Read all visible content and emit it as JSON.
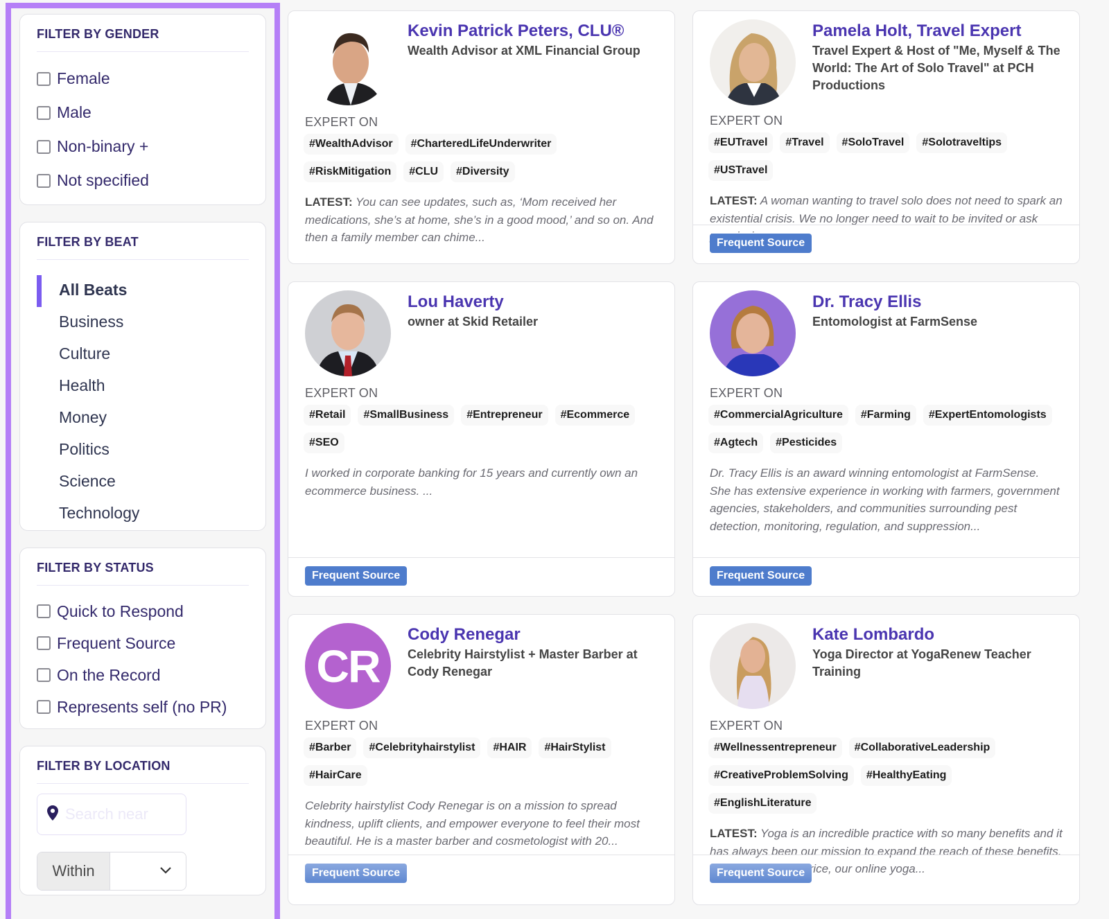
{
  "filters": {
    "gender": {
      "title": "FILTER BY GENDER",
      "options": [
        "Female",
        "Male",
        "Non-binary +",
        "Not specified"
      ]
    },
    "beat": {
      "title": "FILTER BY BEAT",
      "selected": "All Beats",
      "options": [
        "All Beats",
        "Business",
        "Culture",
        "Health",
        "Money",
        "Politics",
        "Science",
        "Technology"
      ]
    },
    "status": {
      "title": "FILTER BY STATUS",
      "options": [
        "Quick to Respond",
        "Frequent Source",
        "On the Record",
        "Represents self (no PR)"
      ]
    },
    "location": {
      "title": "FILTER BY LOCATION",
      "search_placeholder": "Search near",
      "search_icon": "map-pin-icon",
      "within_label": "Within",
      "within_value": ""
    }
  },
  "colors": {
    "accent": "#7b5cf0",
    "sidebar_border": "#b57ff7",
    "name": "#4a35b0",
    "heading": "#33296b",
    "badge": "#4e7ccc",
    "initials_avatar": "#b462cf"
  },
  "expert_on_label": "EXPERT ON",
  "latest_label": "LATEST:",
  "experts": [
    {
      "name": "Kevin Patrick Peters, CLU®",
      "title": "Wealth Advisor at XML Financial Group",
      "tags": [
        "#WealthAdvisor",
        "#CharteredLifeUnderwriter",
        "#RiskMitigation",
        "#CLU",
        "#Diversity"
      ],
      "latest": true,
      "blurb": "You can see updates, such as, ‘Mom received her medications, she’s at home, she’s in a good mood,’ and so on. And then a family member can chime...",
      "badge": null
    },
    {
      "name": "Pamela Holt, Travel Expert",
      "title": "Travel Expert & Host of \"Me, Myself & The World: The Art of Solo Travel\" at PCH Productions",
      "tags": [
        "#EUTravel",
        "#Travel",
        "#SoloTravel",
        "#Solotraveltips",
        "#USTravel"
      ],
      "latest": true,
      "blurb": "A woman wanting to travel solo does not need to spark an existential crisis. We no longer need to wait to be invited or ask permission....",
      "badge": "Frequent Source"
    },
    {
      "name": "Lou Haverty",
      "title": "owner at Skid Retailer",
      "tags": [
        "#Retail",
        "#SmallBusiness",
        "#Entrepreneur",
        "#Ecommerce",
        "#SEO"
      ],
      "latest": false,
      "blurb": "I worked in corporate banking for 15 years and currently own an ecommerce business. ...",
      "badge": "Frequent Source"
    },
    {
      "name": "Dr. Tracy Ellis",
      "title": "Entomologist at FarmSense",
      "tags": [
        "#CommercialAgriculture",
        "#Farming",
        "#ExpertEntomologists",
        "#Agtech",
        "#Pesticides"
      ],
      "latest": false,
      "blurb": "Dr. Tracy Ellis is an award winning entomologist at FarmSense. She has extensive experience in working with farmers, government agencies, stakeholders, and communities surrounding pest detection, monitoring, regulation, and suppression...",
      "badge": "Frequent Source"
    },
    {
      "name": "Cody Renegar",
      "title": "Celebrity Hairstylist + Master Barber at Cody Renegar",
      "initials": "CR",
      "tags": [
        "#Barber",
        "#Celebrityhairstylist",
        "#HAIR",
        "#HairStylist",
        "#HairCare"
      ],
      "latest": false,
      "blurb": "Celebrity hairstylist Cody Renegar is on a mission to spread kindness, uplift clients, and empower everyone to feel their most beautiful. He is a master barber and cosmetologist with 20...",
      "badge": "Frequent Source"
    },
    {
      "name": "Kate Lombardo",
      "title": "Yoga Director at YogaRenew Teacher Training",
      "tags": [
        "#Wellnessentrepreneur",
        "#CollaborativeLeadership",
        "#CreativeProblemSolving",
        "#HealthyEating",
        "#EnglishLiterature"
      ],
      "latest": true,
      "blurb": "Yoga is an incredible practice with so many benefits and it has always been our mission to expand the reach of these benefits. For an affordable price, our online yoga...",
      "badge": "Frequent Source"
    }
  ]
}
